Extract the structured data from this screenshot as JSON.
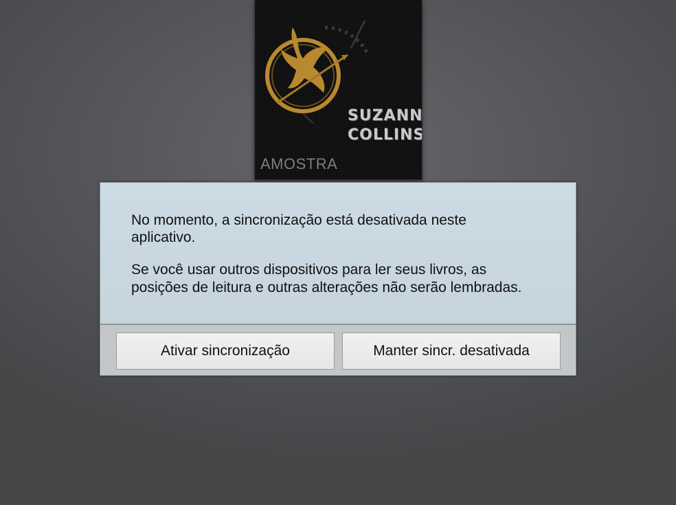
{
  "book": {
    "author_line1": "SUZANNE",
    "author_line2": "COLLINS",
    "badge": "AMOSTRA"
  },
  "dialog": {
    "message_lines": [
      "No momento, a sincronização está desativada neste",
      "aplicativo.",
      " Se você usar outros dispositivos para ler seus livros, as",
      "posições de leitura e outras alterações não serão lembradas."
    ],
    "enable_button": "Ativar sincronização",
    "keep_button": "Manter sincr. desativada"
  },
  "colors": {
    "emblem_gold": "#b8892f",
    "dialog_body": "#ccdce4",
    "dialog_footer": "#c3c7ca"
  },
  "icons": {
    "cover_emblem": "mockingjay-emblem-icon"
  }
}
